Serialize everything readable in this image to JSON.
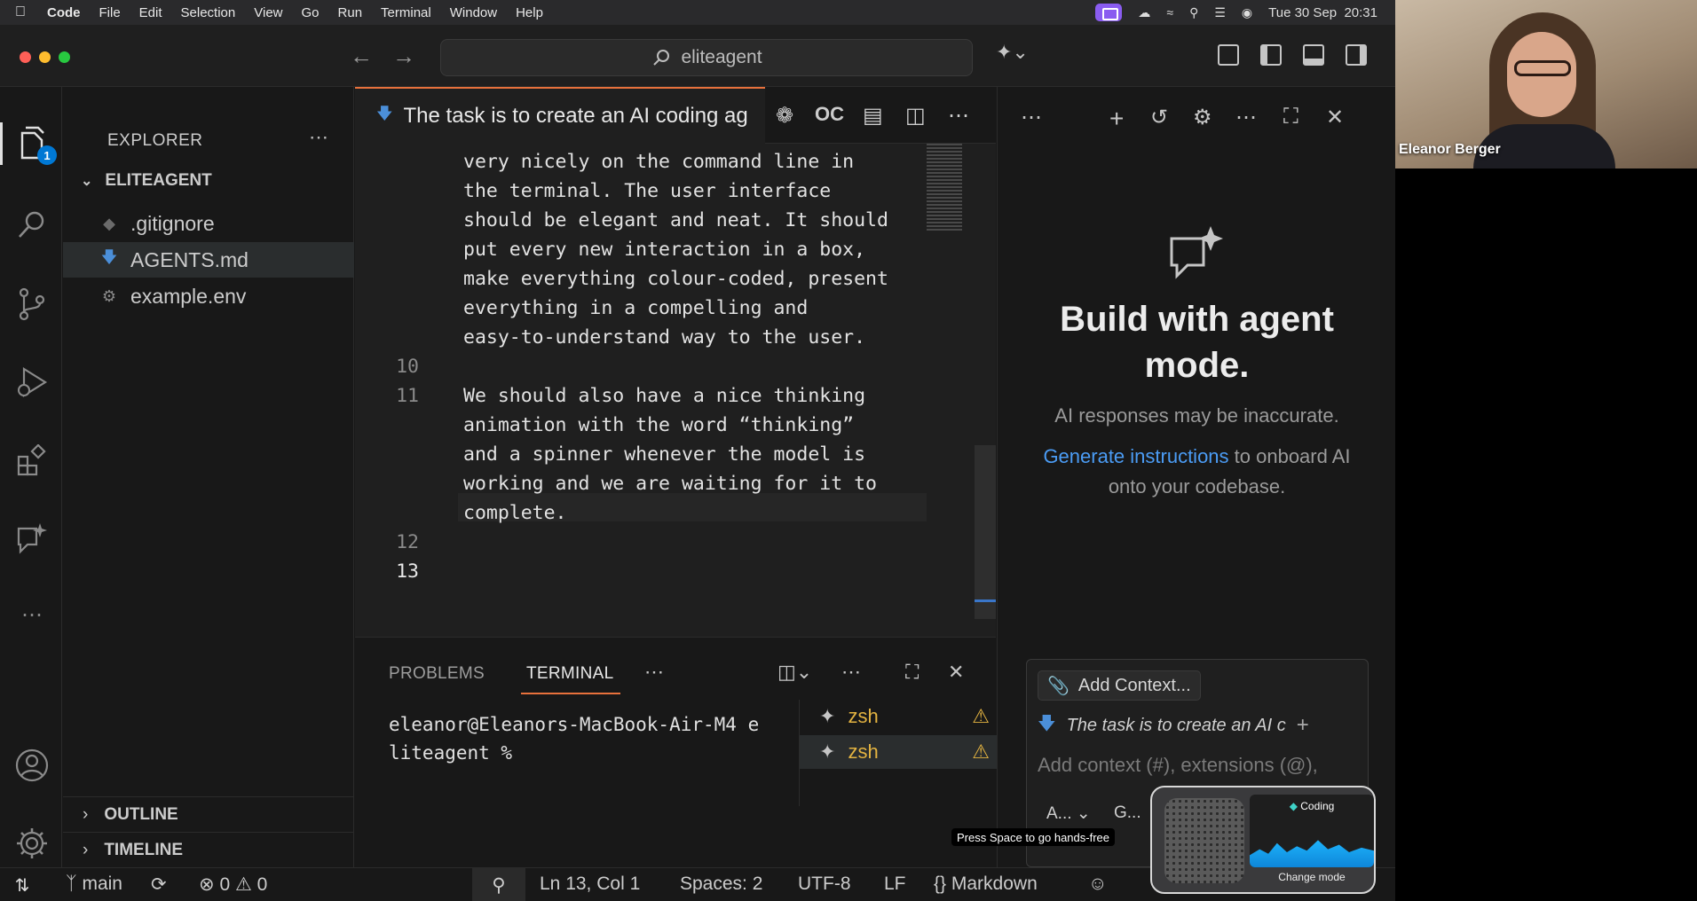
{
  "menubar": {
    "app": "Code",
    "items": [
      "File",
      "Edit",
      "Selection",
      "View",
      "Go",
      "Run",
      "Terminal",
      "Window",
      "Help"
    ],
    "datetime": "Tue 30 Sep  20:31"
  },
  "titlebar": {
    "search": "eliteagent"
  },
  "activity": {
    "explorer_badge": "1"
  },
  "sidebar": {
    "title": "EXPLORER",
    "folder": "ELITEAGENT",
    "files": [
      ".gitignore",
      "AGENTS.md",
      "example.env"
    ],
    "outline": "OUTLINE",
    "timeline": "TIMELINE"
  },
  "editor": {
    "tab": "The task is to create an AI coding ag",
    "line_numbers": {
      "l10": "10",
      "l11": "11",
      "l12": "12",
      "l13": "13"
    },
    "lines": [
      "very nicely on the command line in",
      "the terminal. The user interface",
      "should be elegant and neat. It should",
      "put every new interaction in a box,",
      "make everything colour-coded, present",
      "everything in a compelling and",
      "easy-to-understand way to the user.",
      "We should also have a nice thinking",
      "animation with the word “thinking”",
      "and a spinner whenever the model is",
      "working and we are waiting for it to",
      "complete."
    ]
  },
  "panel": {
    "tabs": [
      "PROBLEMS",
      "TERMINAL"
    ],
    "terminal_line1": "eleanor@Eleanors-MacBook-Air-M4 e",
    "terminal_line2": "liteagent %",
    "sessions": [
      "zsh",
      "zsh"
    ]
  },
  "chat": {
    "heading": "Build with agent mode.",
    "disclaimer": "AI responses may be inaccurate.",
    "link": "Generate instructions",
    "link_rest1": " to onboard AI",
    "link_rest2": "onto your codebase.",
    "add_context": "Add Context...",
    "context_file": "The task is to create an AI c",
    "placeholder": "Add context (#), extensions (@),",
    "mode1": "A...",
    "mode2": "G..."
  },
  "statusbar": {
    "branch": "main",
    "errors": "0",
    "warnings": "0",
    "position": "Ln 13, Col 1",
    "spaces": "Spaces: 2",
    "encoding": "UTF-8",
    "eol": "LF",
    "language": "Markdown"
  },
  "video": {
    "name": "Eleanor Berger"
  },
  "widget": {
    "label": "Coding",
    "action": "Change mode",
    "hint": "Press Space to go hands-free"
  },
  "colors": {
    "accent": "#e8713c",
    "link": "#4b9cf5",
    "badge": "#0078d4",
    "warning": "#e3b341"
  }
}
